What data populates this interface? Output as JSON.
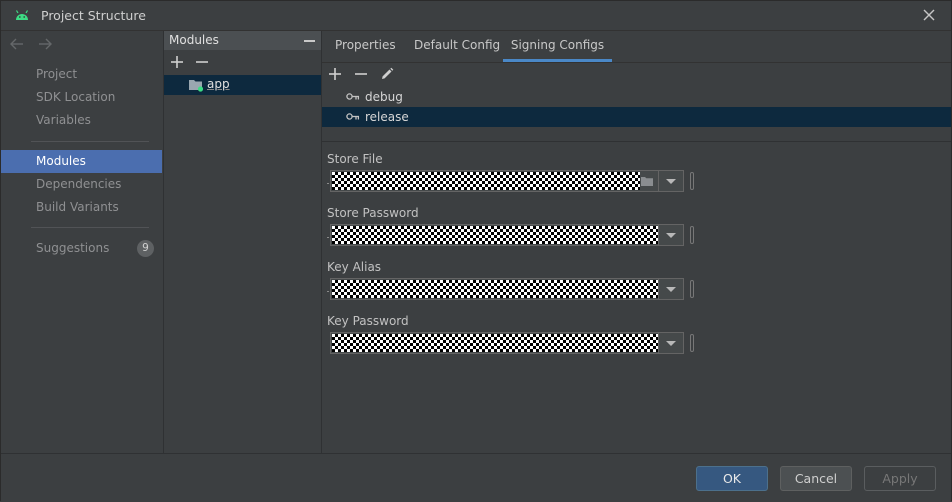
{
  "window": {
    "title": "Project Structure"
  },
  "nav": {
    "items": [
      {
        "label": "Project"
      },
      {
        "label": "SDK Location"
      },
      {
        "label": "Variables"
      },
      {
        "label": "Modules"
      },
      {
        "label": "Dependencies"
      },
      {
        "label": "Build Variants"
      },
      {
        "label": "Suggestions",
        "badge": "9"
      }
    ],
    "selected": "Modules"
  },
  "modules": {
    "header": "Modules",
    "items": [
      {
        "label": "app"
      }
    ]
  },
  "tabs": [
    {
      "label": "Properties"
    },
    {
      "label": "Default Config"
    },
    {
      "label": "Signing Configs"
    }
  ],
  "active_tab": "Signing Configs",
  "signing_configs": [
    {
      "label": "debug"
    },
    {
      "label": "release"
    }
  ],
  "selected_signing_config": "release",
  "fields": {
    "store_file": {
      "label": "Store File"
    },
    "store_password": {
      "label": "Store Password"
    },
    "key_alias": {
      "label": "Key Alias"
    },
    "key_password": {
      "label": "Key Password"
    }
  },
  "buttons": {
    "ok": "OK",
    "cancel": "Cancel",
    "apply": "Apply"
  },
  "colors": {
    "accent": "#4b6eaf",
    "selection": "#0d293e",
    "tab_underline": "#4a88c7",
    "android_green": "#3ddc84"
  }
}
